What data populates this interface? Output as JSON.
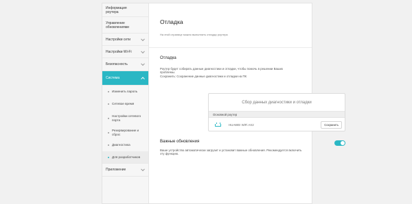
{
  "sidebar": {
    "router_info": "Информация роутера",
    "update_management": "Управление обновлениями",
    "network_settings": "Настройки сети",
    "wifi_settings": "Настройки Wi-Fi",
    "security": "Безопасность",
    "system": "Система",
    "system_items": [
      "Изменить пароль",
      "Сетевое время",
      "Настройки сетевого порта",
      "Резервирование и сброс",
      "Диагностика",
      "Для разработчиков"
    ],
    "app": "Приложение"
  },
  "main": {
    "title": "Отладка",
    "subtitle": "На этой странице можно выполнить отладку роутера",
    "section_title": "Отладка",
    "section_desc": "Роутер будет собирать данные диагностики и отладки, чтобы помочь в решении Ваших проблемы.\nСохранить: Сохранение данные диагностики и отладки на ПК",
    "diag_card": {
      "header": "Сбор данных диагностики и отладки",
      "group_label": "Основной роутер",
      "device_name": "HUAWEI WiFi AX2",
      "save_label": "Сохранить"
    },
    "updates_title": "Важные обновления",
    "updates_desc": "Ваше устройство автоматически загрузит и установит важные обновления. Рекомендуется включить эту функцию.",
    "updates_enabled": true
  },
  "colors": {
    "accent": "#2ab7c4",
    "page_bg": "#f1f1f1",
    "sidebar_bg": "#f6f6f6"
  }
}
